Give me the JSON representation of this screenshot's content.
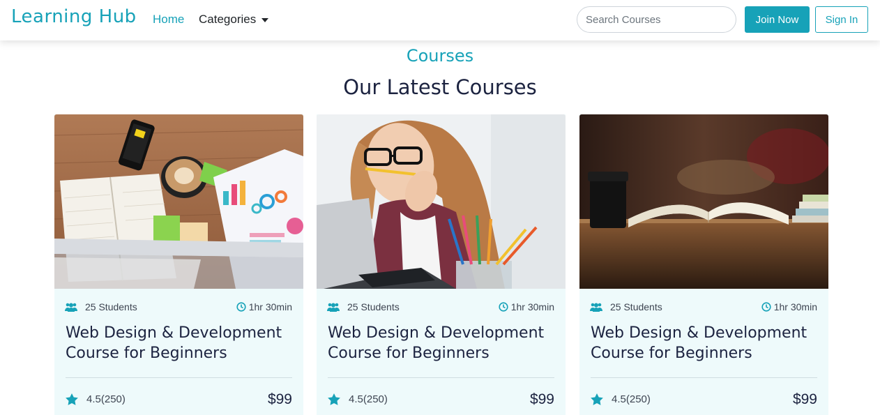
{
  "navbar": {
    "brand": "Learning Hub",
    "home": "Home",
    "categories": "Categories",
    "search_placeholder": "Search Courses",
    "join": "Join Now",
    "signin": "Sign In"
  },
  "section": {
    "subtitle": "Courses",
    "title": "Our Latest Courses"
  },
  "colors": {
    "accent": "#17a2b8",
    "dark": "#1c2340",
    "card_bg": "#eefafb"
  },
  "courses": [
    {
      "students": "25 Students",
      "duration": "1hr 30min",
      "title": "Web Design & Development Course for Beginners",
      "rating": "4.5(250)",
      "price": "$99",
      "image": "desk-with-coffee-and-papers"
    },
    {
      "students": "25 Students",
      "duration": "1hr 30min",
      "title": "Web Design & Development Course for Beginners",
      "rating": "4.5(250)",
      "price": "$99",
      "image": "woman-biting-pencil-at-laptop"
    },
    {
      "students": "25 Students",
      "duration": "1hr 30min",
      "title": "Web Design & Development Course for Beginners",
      "rating": "4.5(250)",
      "price": "$99",
      "image": "open-book-and-cup-in-library"
    }
  ]
}
